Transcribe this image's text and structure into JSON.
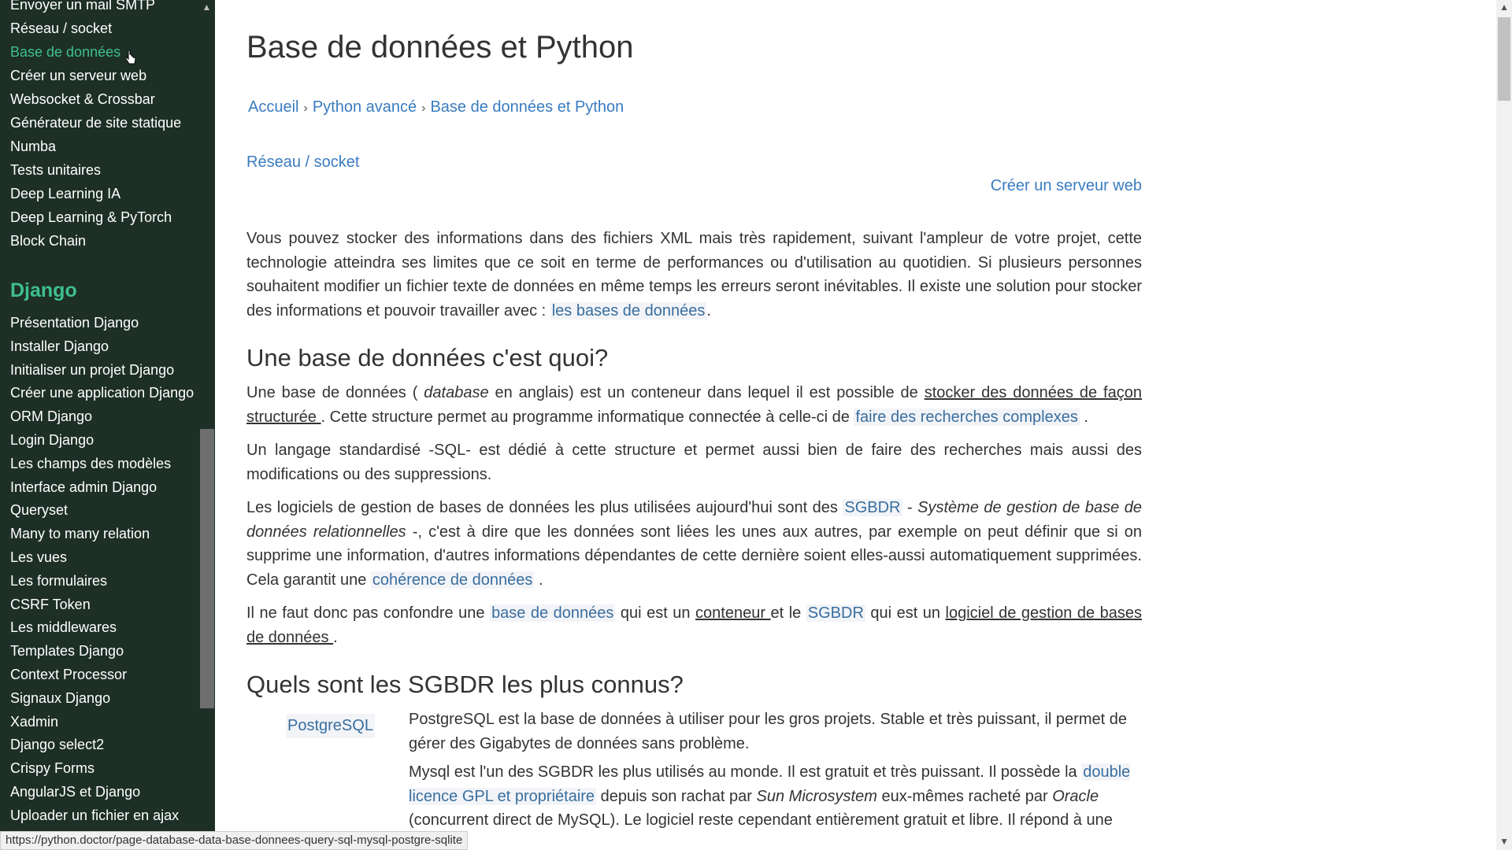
{
  "sidebar": {
    "items_top": [
      {
        "label": "Envoyer un mail SMTP",
        "active": false
      },
      {
        "label": "Réseau / socket",
        "active": false
      },
      {
        "label": "Base de données",
        "active": true
      },
      {
        "label": "Créer un serveur web",
        "active": false
      },
      {
        "label": "Websocket & Crossbar",
        "active": false
      },
      {
        "label": "Générateur de site statique",
        "active": false
      },
      {
        "label": "Numba",
        "active": false
      },
      {
        "label": "Tests unitaires",
        "active": false
      },
      {
        "label": "Deep Learning IA",
        "active": false
      },
      {
        "label": "Deep Learning & PyTorch",
        "active": false
      },
      {
        "label": "Block Chain",
        "active": false
      }
    ],
    "section_title": "Django",
    "items_django": [
      "Présentation Django",
      "Installer Django",
      "Initialiser un projet Django",
      "Créer une application Django",
      "ORM Django",
      "Login Django",
      "Les champs des modèles",
      "Interface admin Django",
      "Queryset",
      "Many to many relation",
      "Les vues",
      "Les formulaires",
      "CSRF Token",
      "Les middlewares",
      "Templates Django",
      "Context Processor",
      "Signaux Django",
      "Xadmin",
      "Django select2",
      "Crispy Forms",
      "AngularJS et Django",
      "Uploader un fichier en ajax"
    ]
  },
  "page": {
    "title": "Base de données et Python",
    "breadcrumb": [
      "Accueil",
      "Python avancé",
      "Base de données et Python"
    ],
    "breadcrumb_sep": "›",
    "prev_link": "Réseau / socket",
    "next_link": "Créer un serveur web"
  },
  "content": {
    "intro": {
      "text": "Vous pouvez stocker des informations dans des fichiers XML mais très rapidement, suivant l'ampleur de votre projet, cette technologie atteindra ses limites que ce soit en terme de performances ou d'utilisation au quotidien. Si plusieurs personnes souhaitent modifier un fichier texte de données en même temps les erreurs seront inévitables. Il existe une solution pour stocker des informations et pouvoir travailler avec : ",
      "link": "les bases de données",
      "end": "."
    },
    "h2_1": "Une base de données c'est quoi?",
    "p1": {
      "a": "Une base de données ( ",
      "em": "database",
      "b": " en anglais) est un conteneur dans lequel il est possible de ",
      "ul": "stocker des données de façon structurée ",
      "c": ". Cette structure permet au programme informatique connectée à celle-ci de ",
      "link": "faire des recherches complexes",
      "d": " ."
    },
    "p2": "Un langage standardisé -SQL- est dédié à cette structure et permet aussi bien de faire des recherches mais aussi des modifications ou des suppressions.",
    "p3": {
      "a": "Les logiciels de gestion de bases de données les plus utilisées aujourd'hui sont des ",
      "link": "SGBDR",
      "b": " - ",
      "em": "Système de gestion de base de données relationnelles",
      "c": " -, c'est à dire que les données sont liées les unes aux autres, par exemple on peut définir que si on supprime une information, d'autres informations dépendantes de cette dernière soient elles-aussi automatiquement supprimées. Cela garantit une ",
      "link2": "cohérence de données",
      "d": " ."
    },
    "p4": {
      "a": "Il ne faut donc pas confondre une ",
      "link": "base de données",
      "b": " qui est un ",
      "ul": "conteneur ",
      "c": "et le ",
      "link2": "SGBDR",
      "d": " qui est un ",
      "ul2": "logiciel de gestion de bases de données ",
      "e": "."
    },
    "h2_2": "Quels sont les SGBDR les plus connus?",
    "sgbd": [
      {
        "name": "PostgreSQL",
        "desc": "PostgreSQL est la base de données à utiliser pour les gros projets. Stable et très puissant, il permet de gérer des Gigabytes de données sans problème."
      },
      {
        "name": "",
        "desc_a": "Mysql est l'un des SGBDR les plus utilisés au monde. Il est gratuit et très puissant. Il possède la ",
        "desc_link": "double licence GPL et propriétaire",
        "desc_b": " depuis son rachat par ",
        "desc_em1": "Sun Microsystem",
        "desc_c": " eux-mêmes racheté par ",
        "desc_em2": "Oracle",
        "desc_d": " (concurrent direct de MySQL). Le logiciel reste cependant entièrement gratuit et libre. Il répond à une"
      }
    ]
  },
  "status_bar": "https://python.doctor/page-database-data-base-donnees-query-sql-mysql-postgre-sqlite",
  "colors": {
    "sidebar_bg": "#1d2f26",
    "accent": "#3fbf8f",
    "link": "#3a7cc0"
  }
}
